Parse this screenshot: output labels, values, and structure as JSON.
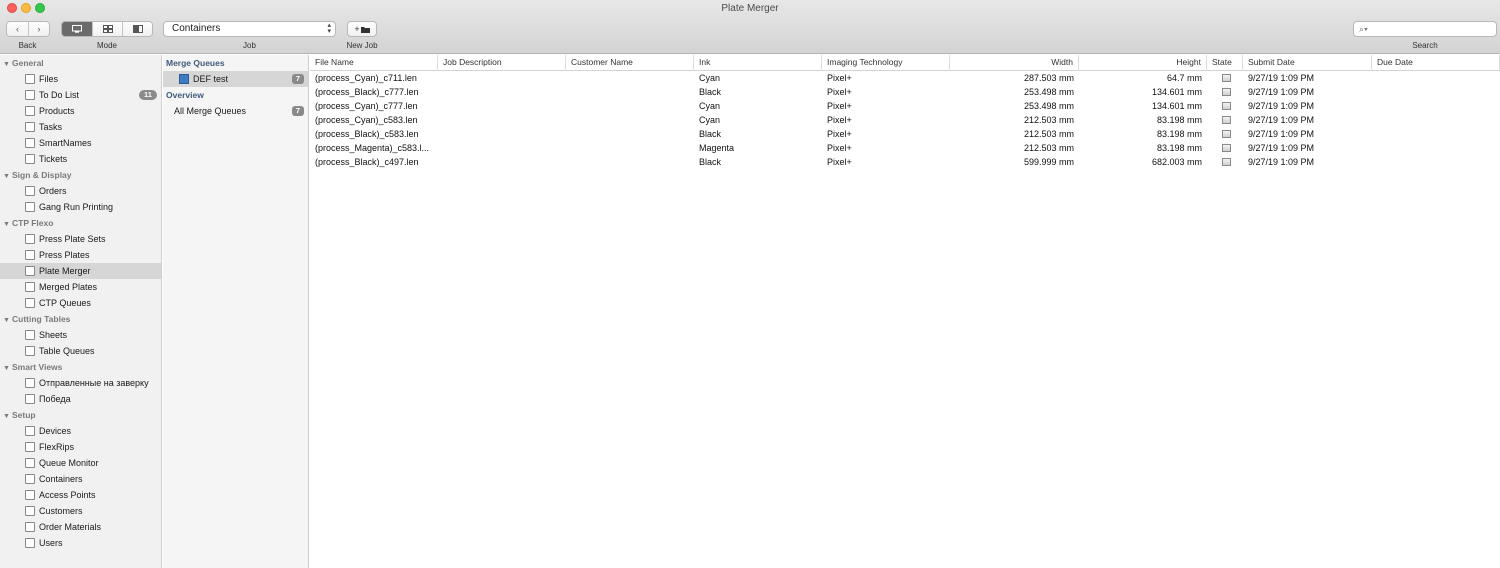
{
  "window": {
    "title": "Plate Merger"
  },
  "toolbar": {
    "back_label": "Back",
    "mode_label": "Mode",
    "job_label": "Job",
    "job_value": "Containers",
    "new_job_label": "New Job",
    "new_job_icon": "+",
    "search_label": "Search",
    "search_placeholder": ""
  },
  "sidebar": {
    "groups": [
      {
        "label": "General",
        "items": [
          {
            "label": "Files",
            "icon": "files-icon"
          },
          {
            "label": "To Do List",
            "icon": "todo-icon",
            "badge": "11"
          },
          {
            "label": "Products",
            "icon": "products-icon"
          },
          {
            "label": "Tasks",
            "icon": "tasks-icon"
          },
          {
            "label": "SmartNames",
            "icon": "smartnames-icon"
          },
          {
            "label": "Tickets",
            "icon": "tickets-icon"
          }
        ]
      },
      {
        "label": "Sign & Display",
        "items": [
          {
            "label": "Orders",
            "icon": "orders-icon"
          },
          {
            "label": "Gang Run Printing",
            "icon": "gang-run-icon"
          }
        ]
      },
      {
        "label": "CTP Flexo",
        "items": [
          {
            "label": "Press Plate Sets",
            "icon": "press-plate-sets-icon"
          },
          {
            "label": "Press Plates",
            "icon": "press-plates-icon"
          },
          {
            "label": "Plate Merger",
            "icon": "plate-merger-icon",
            "selected": true
          },
          {
            "label": "Merged Plates",
            "icon": "merged-plates-icon"
          },
          {
            "label": "CTP Queues",
            "icon": "ctp-queues-icon"
          }
        ]
      },
      {
        "label": "Cutting Tables",
        "items": [
          {
            "label": "Sheets",
            "icon": "sheets-icon"
          },
          {
            "label": "Table Queues",
            "icon": "table-queues-icon"
          }
        ]
      },
      {
        "label": "Smart Views",
        "items": [
          {
            "label": "Отправленные на заверку",
            "icon": "smart-view-icon"
          },
          {
            "label": "Победа",
            "icon": "smart-view-icon"
          }
        ]
      },
      {
        "label": "Setup",
        "items": [
          {
            "label": "Devices",
            "icon": "devices-icon"
          },
          {
            "label": "FlexRips",
            "icon": "flexrips-icon"
          },
          {
            "label": "Queue Monitor",
            "icon": "queue-monitor-icon"
          },
          {
            "label": "Containers",
            "icon": "containers-icon"
          },
          {
            "label": "Access Points",
            "icon": "access-points-icon"
          },
          {
            "label": "Customers",
            "icon": "customers-icon"
          },
          {
            "label": "Order Materials",
            "icon": "order-materials-icon"
          },
          {
            "label": "Users",
            "icon": "users-icon"
          }
        ]
      }
    ]
  },
  "queues": {
    "merge_header": "Merge Queues",
    "merge_items": [
      {
        "label": "DEF test",
        "count": "7"
      }
    ],
    "overview_header": "Overview",
    "overview_items": [
      {
        "label": "All Merge Queues",
        "count": "7"
      }
    ]
  },
  "table": {
    "columns": [
      "File Name",
      "Job Description",
      "Customer Name",
      "Ink",
      "Imaging Technology",
      "Width",
      "Height",
      "State",
      "Submit Date",
      "Due Date"
    ],
    "rows": [
      [
        "(process_Cyan)_c711.len",
        "",
        "",
        "Cyan",
        "Pixel+",
        "287.503 mm",
        "64.7 mm",
        "",
        "9/27/19 1:09 PM",
        ""
      ],
      [
        "(process_Black)_c777.len",
        "",
        "",
        "Black",
        "Pixel+",
        "253.498 mm",
        "134.601 mm",
        "",
        "9/27/19 1:09 PM",
        ""
      ],
      [
        "(process_Cyan)_c777.len",
        "",
        "",
        "Cyan",
        "Pixel+",
        "253.498 mm",
        "134.601 mm",
        "",
        "9/27/19 1:09 PM",
        ""
      ],
      [
        "(process_Cyan)_c583.len",
        "",
        "",
        "Cyan",
        "Pixel+",
        "212.503 mm",
        "83.198 mm",
        "",
        "9/27/19 1:09 PM",
        ""
      ],
      [
        "(process_Black)_c583.len",
        "",
        "",
        "Black",
        "Pixel+",
        "212.503 mm",
        "83.198 mm",
        "",
        "9/27/19 1:09 PM",
        ""
      ],
      [
        "(process_Magenta)_c583.l...",
        "",
        "",
        "Magenta",
        "Pixel+",
        "212.503 mm",
        "83.198 mm",
        "",
        "9/27/19 1:09 PM",
        ""
      ],
      [
        "(process_Black)_c497.len",
        "",
        "",
        "Black",
        "Pixel+",
        "599.999 mm",
        "682.003 mm",
        "",
        "9/27/19 1:09 PM",
        ""
      ]
    ]
  }
}
